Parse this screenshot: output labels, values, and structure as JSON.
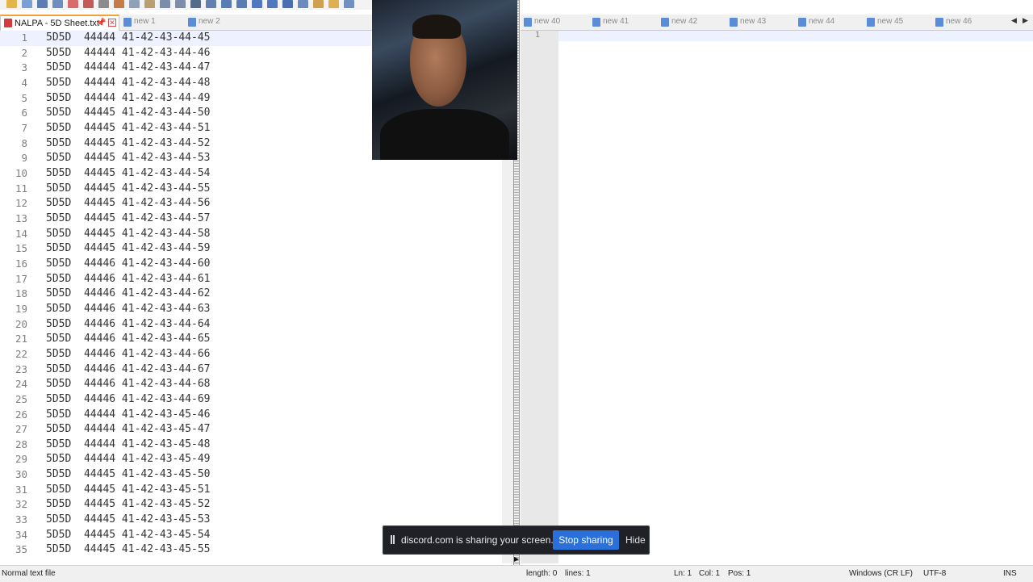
{
  "left_tabs": [
    {
      "label": "NALPA - 5D Sheet.txt",
      "active": true
    },
    {
      "label": "new 1",
      "active": false
    },
    {
      "label": "new 2",
      "active": false
    }
  ],
  "right_tabs": [
    {
      "label": "new 40"
    },
    {
      "label": "new 41"
    },
    {
      "label": "new 42"
    },
    {
      "label": "new 43"
    },
    {
      "label": "new 44"
    },
    {
      "label": "new 45"
    },
    {
      "label": "new 46"
    }
  ],
  "editor_lines": [
    {
      "n": "1",
      "text": "5D5D  44444 41-42-43-44-45"
    },
    {
      "n": "2",
      "text": "5D5D  44444 41-42-43-44-46"
    },
    {
      "n": "3",
      "text": "5D5D  44444 41-42-43-44-47"
    },
    {
      "n": "4",
      "text": "5D5D  44444 41-42-43-44-48"
    },
    {
      "n": "5",
      "text": "5D5D  44444 41-42-43-44-49"
    },
    {
      "n": "6",
      "text": "5D5D  44445 41-42-43-44-50"
    },
    {
      "n": "7",
      "text": "5D5D  44445 41-42-43-44-51"
    },
    {
      "n": "8",
      "text": "5D5D  44445 41-42-43-44-52"
    },
    {
      "n": "9",
      "text": "5D5D  44445 41-42-43-44-53"
    },
    {
      "n": "10",
      "text": "5D5D  44445 41-42-43-44-54"
    },
    {
      "n": "11",
      "text": "5D5D  44445 41-42-43-44-55"
    },
    {
      "n": "12",
      "text": "5D5D  44445 41-42-43-44-56"
    },
    {
      "n": "13",
      "text": "5D5D  44445 41-42-43-44-57"
    },
    {
      "n": "14",
      "text": "5D5D  44445 41-42-43-44-58"
    },
    {
      "n": "15",
      "text": "5D5D  44445 41-42-43-44-59"
    },
    {
      "n": "16",
      "text": "5D5D  44446 41-42-43-44-60"
    },
    {
      "n": "17",
      "text": "5D5D  44446 41-42-43-44-61"
    },
    {
      "n": "18",
      "text": "5D5D  44446 41-42-43-44-62"
    },
    {
      "n": "19",
      "text": "5D5D  44446 41-42-43-44-63"
    },
    {
      "n": "20",
      "text": "5D5D  44446 41-42-43-44-64"
    },
    {
      "n": "21",
      "text": "5D5D  44446 41-42-43-44-65"
    },
    {
      "n": "22",
      "text": "5D5D  44446 41-42-43-44-66"
    },
    {
      "n": "23",
      "text": "5D5D  44446 41-42-43-44-67"
    },
    {
      "n": "24",
      "text": "5D5D  44446 41-42-43-44-68"
    },
    {
      "n": "25",
      "text": "5D5D  44446 41-42-43-44-69"
    },
    {
      "n": "26",
      "text": "5D5D  44444 41-42-43-45-46"
    },
    {
      "n": "27",
      "text": "5D5D  44444 41-42-43-45-47"
    },
    {
      "n": "28",
      "text": "5D5D  44444 41-42-43-45-48"
    },
    {
      "n": "29",
      "text": "5D5D  44444 41-42-43-45-49"
    },
    {
      "n": "30",
      "text": "5D5D  44445 41-42-43-45-50"
    },
    {
      "n": "31",
      "text": "5D5D  44445 41-42-43-45-51"
    },
    {
      "n": "32",
      "text": "5D5D  44445 41-42-43-45-52"
    },
    {
      "n": "33",
      "text": "5D5D  44445 41-42-43-45-53"
    },
    {
      "n": "34",
      "text": "5D5D  44445 41-42-43-45-54"
    },
    {
      "n": "35",
      "text": "5D5D  44445 41-42-43-45-55"
    }
  ],
  "right_editor": {
    "line_number": "1"
  },
  "toolbar_icons": [
    "new-file-icon",
    "open-file-icon",
    "save-icon",
    "save-all-icon",
    "close-icon",
    "close-all-icon",
    "print-icon",
    "cut-icon",
    "copy-icon",
    "paste-icon",
    "undo-icon",
    "redo-icon",
    "find-icon",
    "replace-icon",
    "zoom-in-icon",
    "zoom-out-icon",
    "sync-vertical-icon",
    "sync-horizontal-icon",
    "word-wrap-icon",
    "show-all-chars-icon",
    "indent-guide-icon",
    "folder-icon",
    "document-map-icon"
  ],
  "status": {
    "file_type": "Normal text file",
    "length": "length: 0",
    "lines": "lines: 1",
    "ln": "Ln: 1",
    "col": "Col: 1",
    "pos": "Pos: 1",
    "eol": "Windows (CR LF)",
    "encoding": "UTF-8",
    "mode": "INS"
  },
  "share_bar": {
    "message": "discord.com is sharing your screen.",
    "stop_label": "Stop sharing",
    "hide_label": "Hide"
  },
  "colors": {
    "active_tab_accent": "#f2a33a",
    "current_line": "#eef1ff",
    "stop_button": "#2b6fdb"
  }
}
